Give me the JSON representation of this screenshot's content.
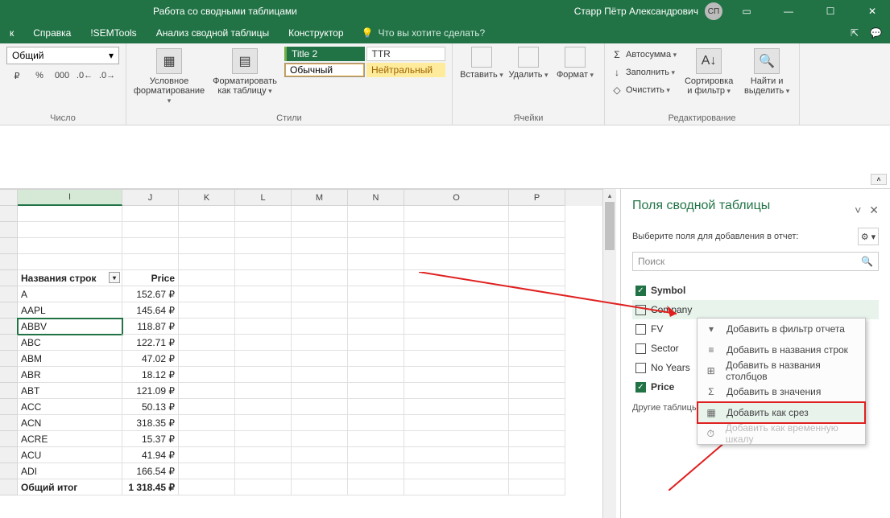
{
  "titlebar": {
    "pivot_tools": "Работа со сводными таблицами",
    "user_name": "Старр Пётр Александрович",
    "user_initials": "СП"
  },
  "menubar": {
    "tabs": [
      "к",
      "Справка",
      "!SEMTools",
      "Анализ сводной таблицы",
      "Конструктор"
    ],
    "tellme": "Что вы хотите сделать?"
  },
  "ribbon": {
    "number": {
      "format": "Общий",
      "group_label": "Число",
      "btns": [
        "₽",
        "%",
        "000",
        ".0←",
        ".0→"
      ]
    },
    "styles": {
      "cond_fmt": "Условное форматирование",
      "fmt_table": "Форматировать как таблицу",
      "title2": "Title 2",
      "ttr": "TTR",
      "normal": "Обычный",
      "neutral": "Нейтральный",
      "group_label": "Стили"
    },
    "cells": {
      "insert": "Вставить",
      "delete": "Удалить",
      "format": "Формат",
      "group_label": "Ячейки"
    },
    "editing": {
      "autosum": "Автосумма",
      "fill": "Заполнить",
      "clear": "Очистить",
      "sort": "Сортировка и фильтр",
      "find": "Найти и выделить",
      "group_label": "Редактирование"
    }
  },
  "columns": [
    "I",
    "J",
    "K",
    "L",
    "M",
    "N",
    "O",
    "P"
  ],
  "table": {
    "row_labels_header": "Названия строк",
    "price_header": "Price",
    "currency": "₽",
    "rows": [
      {
        "label": "A",
        "price": "152.67 ₽"
      },
      {
        "label": "AAPL",
        "price": "145.64 ₽"
      },
      {
        "label": "ABBV",
        "price": "118.87 ₽",
        "selected": true
      },
      {
        "label": "ABC",
        "price": "122.71 ₽"
      },
      {
        "label": "ABM",
        "price": "47.02 ₽"
      },
      {
        "label": "ABR",
        "price": "18.12 ₽"
      },
      {
        "label": "ABT",
        "price": "121.09 ₽"
      },
      {
        "label": "ACC",
        "price": "50.13 ₽"
      },
      {
        "label": "ACN",
        "price": "318.35 ₽"
      },
      {
        "label": "ACRE",
        "price": "15.37 ₽"
      },
      {
        "label": "ACU",
        "price": "41.94 ₽"
      },
      {
        "label": "ADI",
        "price": "166.54 ₽"
      }
    ],
    "grand_total_label": "Общий итог",
    "grand_total_value": "1 318.45 ₽"
  },
  "fieldpane": {
    "title": "Поля сводной таблицы",
    "subtitle": "Выберите поля для добавления в отчет:",
    "search_placeholder": "Поиск",
    "fields": [
      {
        "name": "Symbol",
        "checked": true
      },
      {
        "name": "Company",
        "checked": false,
        "hover": true
      },
      {
        "name": "FV",
        "checked": false
      },
      {
        "name": "Sector",
        "checked": false
      },
      {
        "name": "No Years",
        "checked": false
      },
      {
        "name": "Price",
        "checked": true
      }
    ],
    "other_tables": "Другие таблицы..."
  },
  "context_menu": {
    "items": [
      {
        "icon": "▾",
        "label": "Добавить в фильтр отчета"
      },
      {
        "icon": "≡",
        "label": "Добавить в названия строк"
      },
      {
        "icon": "⊞",
        "label": "Добавить в названия столбцов"
      },
      {
        "icon": "Σ",
        "label": "Добавить в значения"
      },
      {
        "icon": "▦",
        "label": "Добавить как срез",
        "highlight": true
      },
      {
        "icon": "⏱",
        "label": "Добавить как временную шкалу",
        "disabled": true
      }
    ]
  }
}
